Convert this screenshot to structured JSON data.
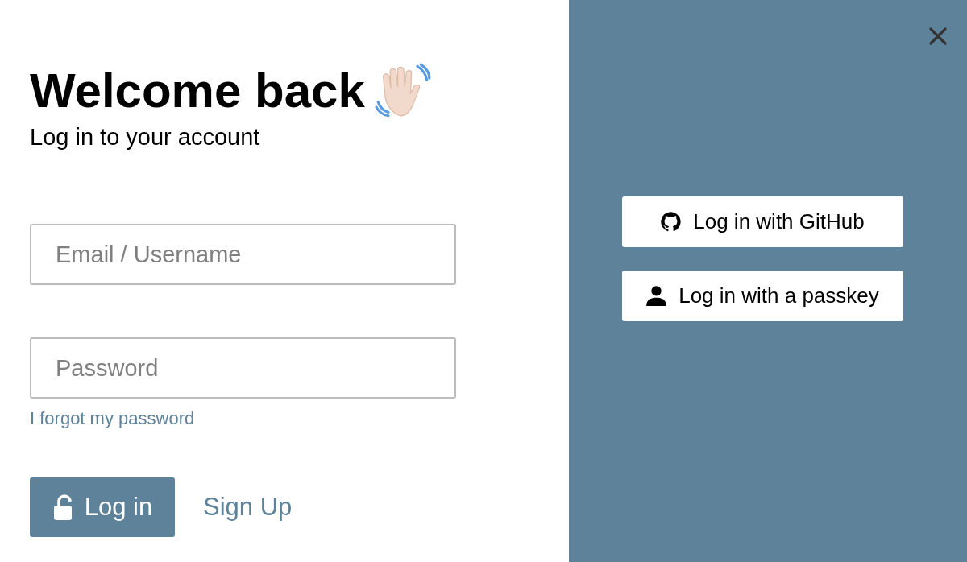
{
  "heading": {
    "title": "Welcome back",
    "subtitle": "Log in to your account"
  },
  "fields": [
    {
      "placeholder": "Email / Username"
    },
    {
      "placeholder": "Password"
    }
  ],
  "forgot_link": "I forgot my password",
  "login_button": "Log in",
  "signup_link": "Sign Up",
  "providers": [
    {
      "kind": "github",
      "label": "Log in with GitHub"
    },
    {
      "kind": "passkey",
      "label": "Log in with a passkey"
    }
  ]
}
